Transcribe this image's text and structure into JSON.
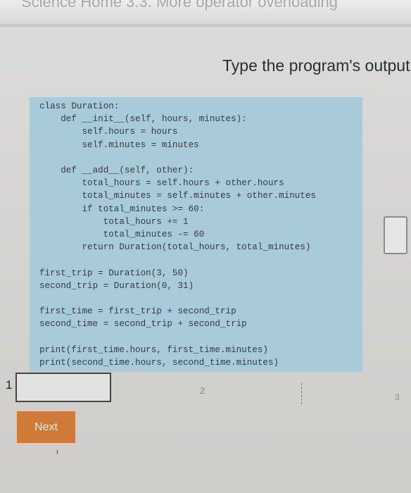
{
  "top_bar": {
    "title": "Science Home 3.3. More operator overloading"
  },
  "heading": "Type the program's output",
  "code_lines": [
    "class Duration:",
    "    def __init__(self, hours, minutes):",
    "        self.hours = hours",
    "        self.minutes = minutes",
    "",
    "    def __add__(self, other):",
    "        total_hours = self.hours + other.hours",
    "        total_minutes = self.minutes + other.minutes",
    "        if total_minutes >= 60:",
    "            total_hours += 1",
    "            total_minutes -= 60",
    "        return Duration(total_hours, total_minutes)",
    "",
    "first_trip = Duration(3, 50)",
    "second_trip = Duration(0, 31)",
    "",
    "first_time = first_trip + second_trip",
    "second_time = second_trip + second_trip",
    "",
    "print(first_time.hours, first_time.minutes)",
    "print(second_time.hours, second_time.minutes)"
  ],
  "answer": {
    "value": ""
  },
  "progress": {
    "current": "1",
    "step2": "2",
    "step3": "3"
  },
  "next_button": {
    "label": "Next"
  }
}
